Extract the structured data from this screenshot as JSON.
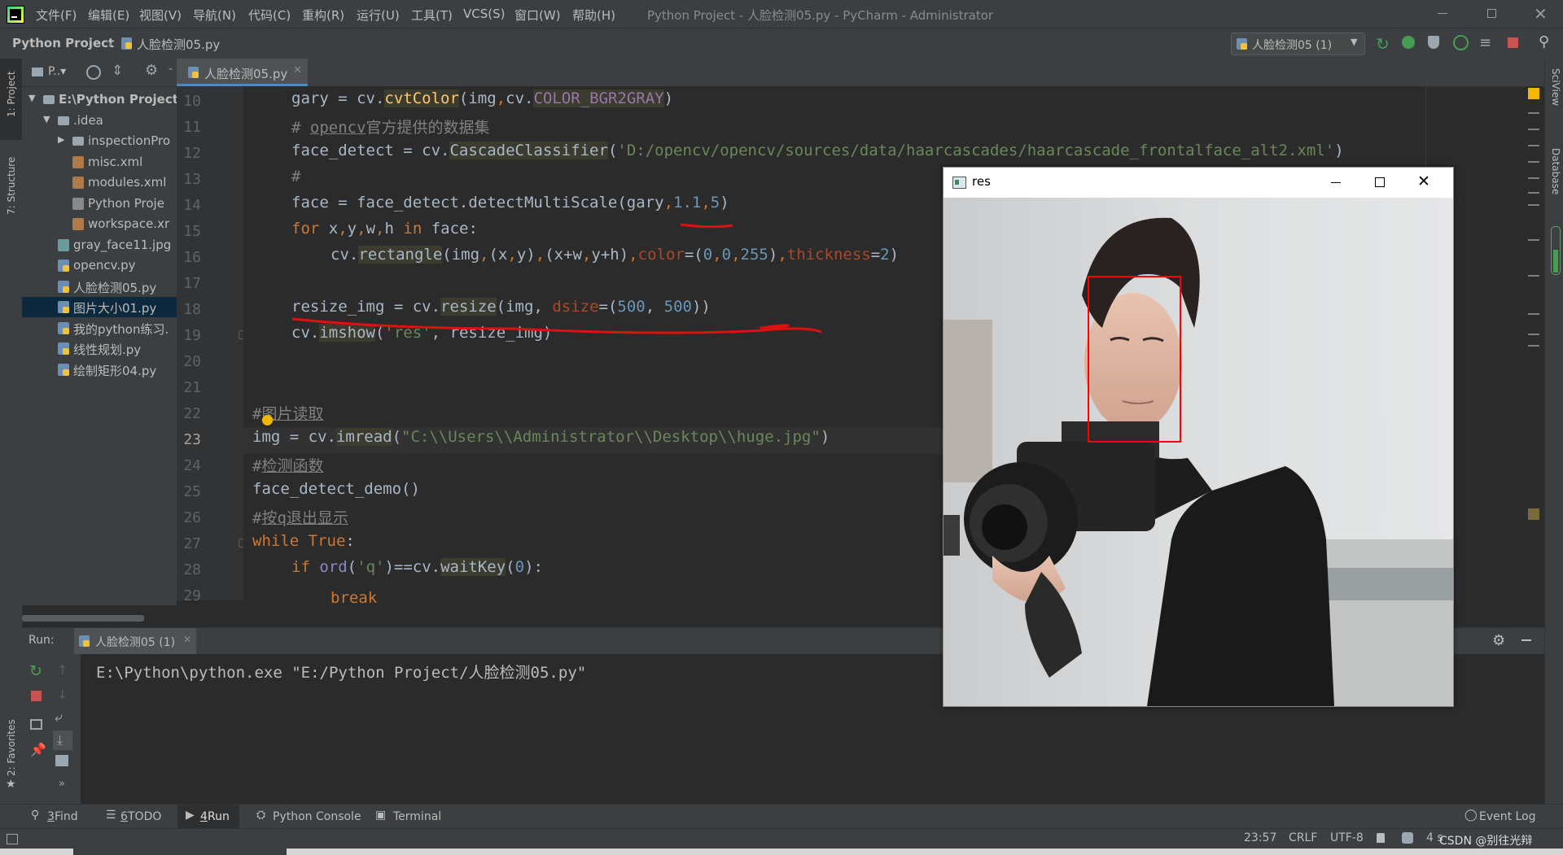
{
  "app": {
    "window_title": "Python Project - 人脸检测05.py - PyCharm - Administrator",
    "menu": [
      "文件(F)",
      "编辑(E)",
      "视图(V)",
      "导航(N)",
      "代码(C)",
      "重构(R)",
      "运行(U)",
      "工具(T)",
      "VCS(S)",
      "窗口(W)",
      "帮助(H)"
    ]
  },
  "navbar": {
    "project": "Python Project",
    "file": "人脸检测05.py",
    "run_config": "人脸检测05 (1)"
  },
  "left_strip": {
    "project": "1: Project",
    "structure": "7: Structure",
    "favorites": "2: Favorites"
  },
  "right_strip": {
    "sciview": "SciView",
    "database": "Database"
  },
  "project_panel": {
    "header_label": "P..▾",
    "tree": [
      {
        "label": "E:\\Python Project",
        "indent": 0,
        "type": "folder",
        "bold": true
      },
      {
        "label": ".idea",
        "indent": 1,
        "type": "folder"
      },
      {
        "label": "inspectionPro",
        "indent": 2,
        "type": "folder"
      },
      {
        "label": "misc.xml",
        "indent": 2,
        "type": "xml"
      },
      {
        "label": "modules.xml",
        "indent": 2,
        "type": "xml"
      },
      {
        "label": "Python Proje",
        "indent": 2,
        "type": "file"
      },
      {
        "label": "workspace.xr",
        "indent": 2,
        "type": "xml"
      },
      {
        "label": "gray_face11.jpg",
        "indent": 1,
        "type": "img"
      },
      {
        "label": "opencv.py",
        "indent": 1,
        "type": "py"
      },
      {
        "label": "人脸检测05.py",
        "indent": 1,
        "type": "py"
      },
      {
        "label": "图片大小01.py",
        "indent": 1,
        "type": "py",
        "selected": true
      },
      {
        "label": "我的python练习.",
        "indent": 1,
        "type": "py"
      },
      {
        "label": "线性规划.py",
        "indent": 1,
        "type": "py"
      },
      {
        "label": "绘制矩形04.py",
        "indent": 1,
        "type": "py"
      }
    ]
  },
  "editor": {
    "tab": "人脸检测05.py",
    "line_numbers": [
      "10",
      "11",
      "12",
      "13",
      "14",
      "15",
      "16",
      "17",
      "18",
      "19",
      "20",
      "21",
      "22",
      "23",
      "24",
      "25",
      "26",
      "27",
      "28",
      "29"
    ],
    "lines": {
      "l10": {
        "a": "gary = cv.",
        "b": "cvtColor",
        "c": "(img",
        "d": ",",
        "e": "cv.",
        "f": "COLOR_BGR2GRAY",
        "g": ")"
      },
      "l11": {
        "a": "# ",
        "b": "opencv",
        "c": "官方提供的数据集"
      },
      "l12": {
        "a": "face_detect = cv.",
        "b": "CascadeClassifier",
        "c": "(",
        "d": "'D:/opencv/opencv/sources/data/haarcascades/haarcascade_frontalface_alt2.xml'",
        "e": ")"
      },
      "l13": {
        "a": "#"
      },
      "l14": {
        "a": "face = face_detect.detectMultiScale(gary",
        "b": ",",
        "c": "1.1",
        "d": ",",
        "e": "5",
        "f": ")"
      },
      "l15": {
        "a": "for",
        "b": " x",
        "c": ",",
        "d": "y",
        "e": ",",
        "f": "w",
        "g": ",",
        "h": "h ",
        "i": "in",
        "j": " face:"
      },
      "l16": {
        "a": "cv.",
        "b": "rectangle",
        "c": "(img",
        "d": ",",
        "e": "(x",
        "f": ",",
        "g": "y)",
        "h": ",",
        "i": "(x+w",
        "j": ",",
        "k": "y+h)",
        "l": ",",
        "m": "color",
        "n": "=(",
        "o": "0",
        "p": ",",
        "q": "0",
        "r": ",",
        "s": "255",
        "t": ")",
        "u": ",",
        "v": "thickness",
        "w": "=",
        "x": "2",
        "y": ")"
      },
      "l18": {
        "a": "resize_img = cv.",
        "b": "resize",
        "c": "(img, ",
        "d": "dsize",
        "e": "=(",
        "f": "500",
        "g": ", ",
        "h": "500",
        "i": "))"
      },
      "l19": {
        "a": "cv.",
        "b": "imshow",
        "c": "(",
        "d": "'res'",
        "e": ", resize_img)"
      },
      "l22": {
        "a": "#",
        "b": "图片读取"
      },
      "l23": {
        "a": "img = cv.",
        "b": "imread",
        "c": "(",
        "d": "\"C:\\\\Users\\\\Administrator\\\\Desktop\\\\huge.jpg\"",
        "e": ")"
      },
      "l24": {
        "a": "#",
        "b": "检测函数"
      },
      "l25": {
        "a": "face_detect_demo()"
      },
      "l26": {
        "a": "#",
        "b": "按q退出显示"
      },
      "l27": {
        "a": "while",
        "b": " ",
        "c": "True",
        "d": ":"
      },
      "l28": {
        "a": "if",
        "b": " ",
        "c": "ord",
        "d": "(",
        "e": "'q'",
        "f": ")==cv.",
        "g": "waitKey",
        "h": "(",
        "i": "0",
        "j": "):"
      },
      "l29": {
        "a": "break"
      }
    }
  },
  "image_window": {
    "title": "res"
  },
  "run_panel": {
    "label": "Run:",
    "tab": "人脸检测05 (1)",
    "output": "E:\\Python\\python.exe \"E:/Python Project/人脸检测05.py\""
  },
  "bottom_tabs": [
    {
      "num": "3",
      "label": "Find",
      "icon": "search-icon"
    },
    {
      "num": "6",
      "label": "TODO",
      "icon": "list-icon"
    },
    {
      "num": "4",
      "label": "Run",
      "icon": "play-icon",
      "active": true
    },
    {
      "num": "",
      "label": "Python Console",
      "icon": "python-icon"
    },
    {
      "num": "",
      "label": "Terminal",
      "icon": "terminal-icon"
    }
  ],
  "event_log": "Event Log",
  "status": {
    "position": "23:57",
    "line_sep": "CRLF",
    "encoding": "UTF-8",
    "indent": "4 s",
    "watermark": "CSDN @别往光辩"
  },
  "colors": {
    "keyword": "#cc7832",
    "string": "#6a8759",
    "number": "#6897bb",
    "function": "#ffc66d",
    "comment": "#808080",
    "annotation_red": "#e01010"
  }
}
